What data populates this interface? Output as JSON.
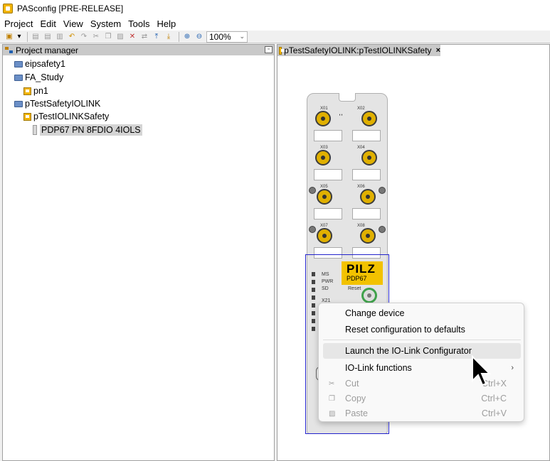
{
  "window": {
    "title": "PASconfig [PRE-RELEASE]"
  },
  "menu": [
    "Project",
    "Edit",
    "View",
    "System",
    "Tools",
    "Help"
  ],
  "toolbar": {
    "zoom": "100%"
  },
  "project_manager": {
    "title": "Project manager",
    "tree": [
      {
        "label": "eipsafety1",
        "icon": "folder-icon"
      },
      {
        "label": "FA_Study",
        "icon": "folder-icon"
      },
      {
        "label": "pn1",
        "icon": "project-icon"
      },
      {
        "label": "pTestSafetyIOLINK",
        "icon": "folder-icon"
      },
      {
        "label": "pTestIOLINKSafety",
        "icon": "project-icon"
      },
      {
        "label": "PDP67 PN 8FDIO 4IOLS",
        "icon": "device-icon"
      }
    ]
  },
  "editor_tab": {
    "label": "pTestSafetyIOLINK:pTestIOLINKSafety",
    "close": "×"
  },
  "device": {
    "ports": [
      {
        "left": "X01",
        "right": "X02"
      },
      {
        "left": "X03",
        "right": "X04"
      },
      {
        "left": "X05",
        "right": "X06"
      },
      {
        "left": "X07",
        "right": "X08"
      }
    ],
    "logo": "PILZ",
    "model": "PDP67",
    "leds": [
      "MS",
      "PWR",
      "SD"
    ],
    "reset_label": "Reset",
    "x21_label": "X21"
  },
  "context_menu": {
    "items": [
      {
        "label": "Change device"
      },
      {
        "label": "Reset configuration to defaults"
      },
      {
        "label": "Launch the IO-Link Configurator"
      },
      {
        "label": "IO-Link functions",
        "arrow": "›"
      },
      {
        "label": "Cut",
        "shortcut": "Ctrl+X"
      },
      {
        "label": "Copy",
        "shortcut": "Ctrl+C"
      },
      {
        "label": "Paste",
        "shortcut": "Ctrl+V"
      }
    ]
  }
}
